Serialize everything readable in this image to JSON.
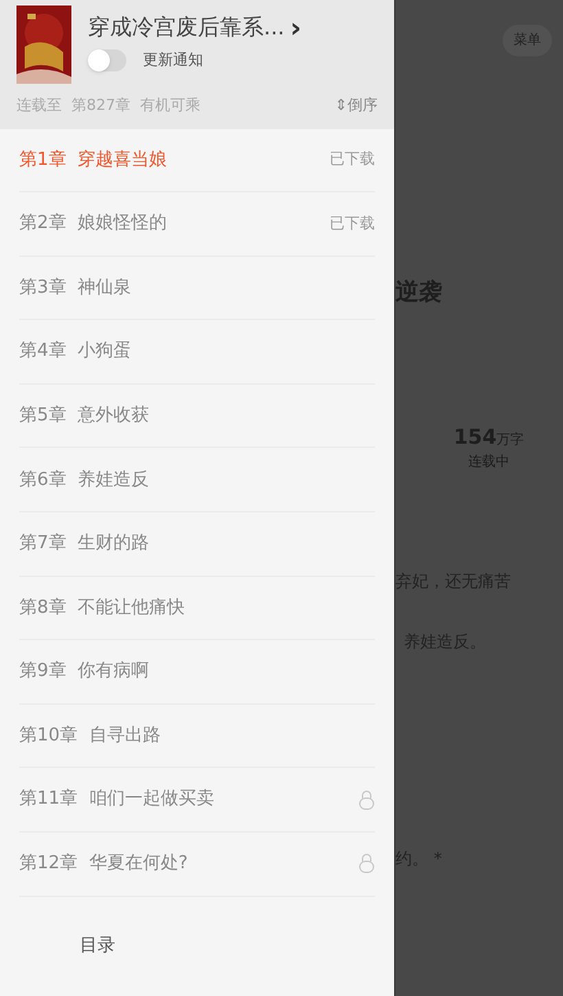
{
  "drawer": {
    "book": {
      "title": "穿成冷宫废后靠系...",
      "chevron": "›",
      "notify_label": "更新通知",
      "notify_on": false
    },
    "status": "连载至  第827章  有机可乘",
    "sort": {
      "arrow": "⇕",
      "label": "倒序"
    },
    "chapters": [
      {
        "number": "第1章",
        "title": "穿越喜当娘",
        "selected": true,
        "kind": "downloaded",
        "badge": "已下载"
      },
      {
        "number": "第2章",
        "title": "娘娘怪怪的",
        "selected": false,
        "kind": "downloaded",
        "badge": "已下载"
      },
      {
        "number": "第3章",
        "title": "神仙泉",
        "selected": false,
        "kind": "plain"
      },
      {
        "number": "第4章",
        "title": "小狗蛋",
        "selected": false,
        "kind": "plain"
      },
      {
        "number": "第5章",
        "title": "意外收获",
        "selected": false,
        "kind": "plain"
      },
      {
        "number": "第6章",
        "title": "养娃造反",
        "selected": false,
        "kind": "plain"
      },
      {
        "number": "第7章",
        "title": "生财的路",
        "selected": false,
        "kind": "plain"
      },
      {
        "number": "第8章",
        "title": "不能让他痛快",
        "selected": false,
        "kind": "plain"
      },
      {
        "number": "第9章",
        "title": "你有病啊",
        "selected": false,
        "kind": "plain"
      },
      {
        "number": "第10章",
        "title": "自寻出路",
        "selected": false,
        "kind": "plain"
      },
      {
        "number": "第11章",
        "title": "咱们一起做买卖",
        "selected": false,
        "kind": "locked"
      },
      {
        "number": "第12章",
        "title": "华夏在何处?",
        "selected": false,
        "kind": "locked"
      }
    ],
    "bottom_tab": "目录"
  },
  "background_page": {
    "menu_button": "菜单",
    "title_fragment": "逆袭",
    "word_count": "154",
    "word_unit": "万字",
    "serial_status": "连载中",
    "intro_line_1": "弃妃，还无痛苦",
    "intro_line_2": "养娃造反。",
    "fragment": "约。 *"
  }
}
